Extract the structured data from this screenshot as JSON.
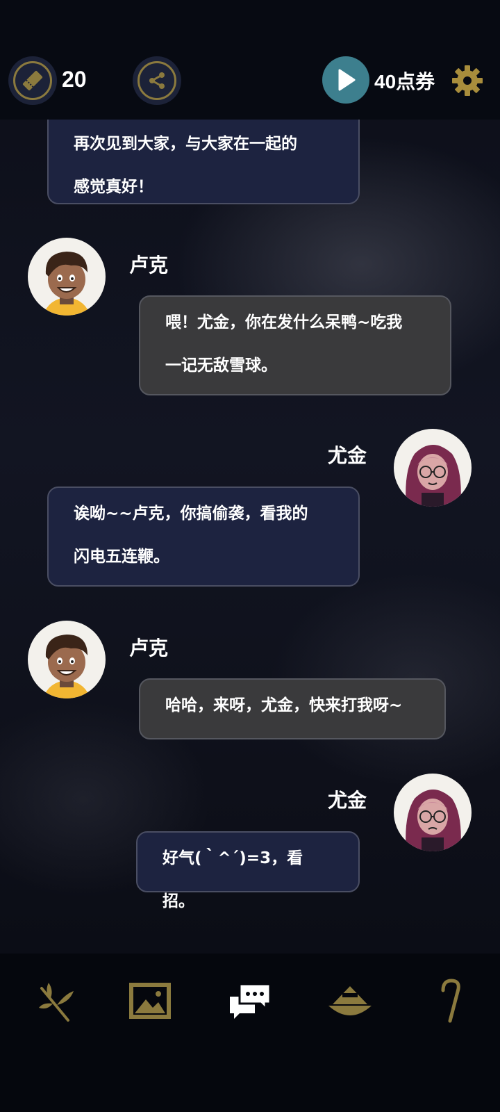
{
  "header": {
    "ticket_count": "20",
    "points_label": "40点券",
    "icons": [
      "ticket-icon",
      "share-icon",
      "play-icon",
      "gear-icon"
    ]
  },
  "messages": [
    {
      "side": "right",
      "speaker": "",
      "lines": [
        "再次见到大家，与大家在一起的",
        "感觉真好！"
      ]
    },
    {
      "side": "left",
      "speaker": "卢克",
      "lines": [
        "喂！尤金，你在发什么呆鸭~吃我",
        "一记无敌雪球。"
      ]
    },
    {
      "side": "right",
      "speaker": "尤金",
      "lines": [
        "诶呦~~卢克，你搞偷袭，看我的",
        "闪电五连鞭。"
      ]
    },
    {
      "side": "left",
      "speaker": "卢克",
      "lines": [
        "哈哈，来呀，尤金，快来打我呀~"
      ]
    },
    {
      "side": "right",
      "speaker": "尤金",
      "lines": [
        "好气(｀^´)=3，看招。"
      ]
    }
  ],
  "nav": {
    "items": [
      "branch-icon",
      "gallery-icon",
      "chat-icon",
      "hat-icon",
      "cane-icon"
    ]
  },
  "colors": {
    "accent_gold": "#8b7a3e",
    "play_teal": "#3d7f8e",
    "bubble_gray": "#3a3a3c",
    "bubble_navy": "#1d2340"
  }
}
